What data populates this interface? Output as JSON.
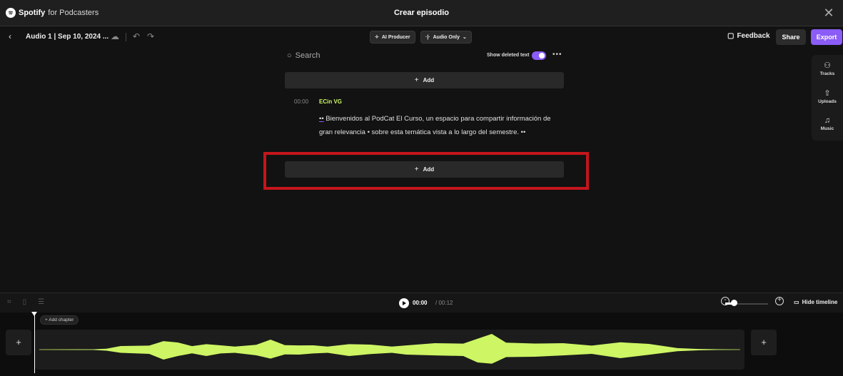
{
  "window": {
    "brand": "Spotify",
    "brand_suffix": "for Podcasters",
    "title": "Crear episodio"
  },
  "toolbar": {
    "episode_name": "Audio 1 | Sep 10, 2024 ...",
    "ai_producer_label": "AI Producer",
    "audio_mode_label": "Audio Only",
    "feedback_label": "Feedback",
    "share_label": "Share",
    "export_label": "Export"
  },
  "editor": {
    "search_placeholder": "Search",
    "show_deleted_label": "Show deleted text",
    "show_deleted_on": true,
    "add_label": "Add",
    "segment": {
      "timestamp": "00:00",
      "speaker": "ECin VG",
      "prefix_dots": "••",
      "text": " Bienvenidos al PodCat El Curso, un espacio para compartir información de gran relevancia • sobre esta temática vista a lo largo del semestre. ••"
    }
  },
  "right_panel": {
    "items": [
      {
        "label": "Tracks",
        "icon": "tracks-icon"
      },
      {
        "label": "Uploads",
        "icon": "upload-icon"
      },
      {
        "label": "Music",
        "icon": "music-icon"
      }
    ]
  },
  "player": {
    "current_time": "00:00",
    "total_time": "/ 00:12",
    "hide_timeline_label": "Hide timeline"
  },
  "timeline": {
    "add_chapter_label": "Add chapter"
  },
  "colors": {
    "accent": "#8b5cf6",
    "waveform": "#cdf564",
    "highlight_box": "#c4161c"
  }
}
